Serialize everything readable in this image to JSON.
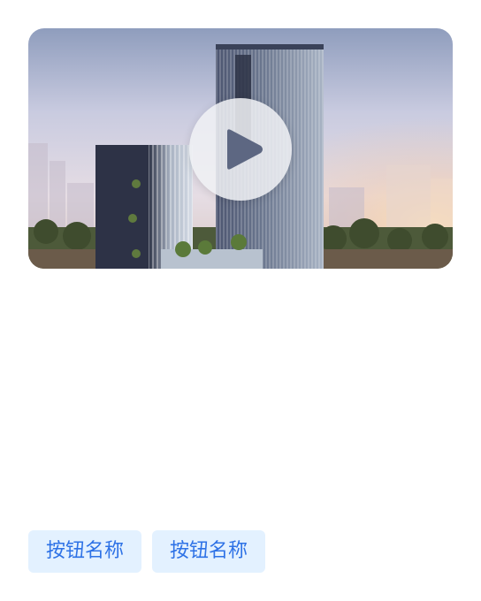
{
  "video": {
    "thumbnail_icon": "building-thumbnail",
    "play_icon": "play-icon"
  },
  "buttons": [
    {
      "label": "按钮名称"
    },
    {
      "label": "按钮名称"
    }
  ],
  "colors": {
    "button_bg": "#e3f1ff",
    "button_text": "#2e72e6",
    "play_overlay": "#f0f1f5",
    "play_triangle": "#5d6782"
  }
}
